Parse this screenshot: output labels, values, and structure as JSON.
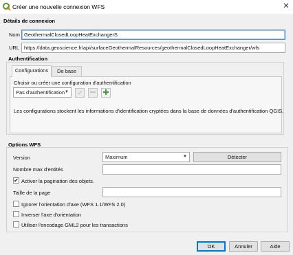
{
  "window": {
    "title": "Créer une nouvelle connexion WFS",
    "close_glyph": "✕"
  },
  "connection": {
    "section_title": "Détails de connexion",
    "name_label": "Nom",
    "name_value": "GeothermalClosedLoopHeatExchangerS",
    "url_label": "URL",
    "url_value": "https://data.geoscience.fr/api/surfaceGeothermalResources/geothermalClosedLoopHeatExchanger/wfs"
  },
  "auth": {
    "section_title": "Authentification",
    "tabs": [
      {
        "label": "Configurations",
        "active": true
      },
      {
        "label": "De base",
        "active": false
      }
    ],
    "choose_label": "Choisir ou créer une configuration d'authentification",
    "config_select": "Pas d'authentification",
    "tools": [
      "edit-icon",
      "remove-icon",
      "add-icon"
    ],
    "info_text": "Les configurations stockent les informations d'identification cryptées dans la base de données d'authentification QGIS."
  },
  "wfs": {
    "section_title": "Options WFS",
    "version_label": "Version",
    "version_value": "Maximum",
    "detect_button": "Détecter",
    "max_entities_label": "Nombre max d'entités",
    "max_entities_value": "",
    "pagination_label": "Activer la pagination des objets.",
    "pagination_checked": true,
    "page_size_label": "Taille de la page",
    "page_size_value": "",
    "options": [
      {
        "label": "Ignorer l'orientation d'axe (WFS 1.1/WFS 2.0)",
        "checked": false
      },
      {
        "label": "Inverser l'axe d'orientation",
        "checked": false
      },
      {
        "label": "Utiliser l'encodage GML2 pour les transactions",
        "checked": false
      }
    ]
  },
  "footer": {
    "ok": "OK",
    "cancel": "Annuler",
    "help": "Aide"
  },
  "colors": {
    "accent": "#0078d7",
    "qgis_green": "#589632",
    "qgis_yellow": "#ee7913"
  }
}
